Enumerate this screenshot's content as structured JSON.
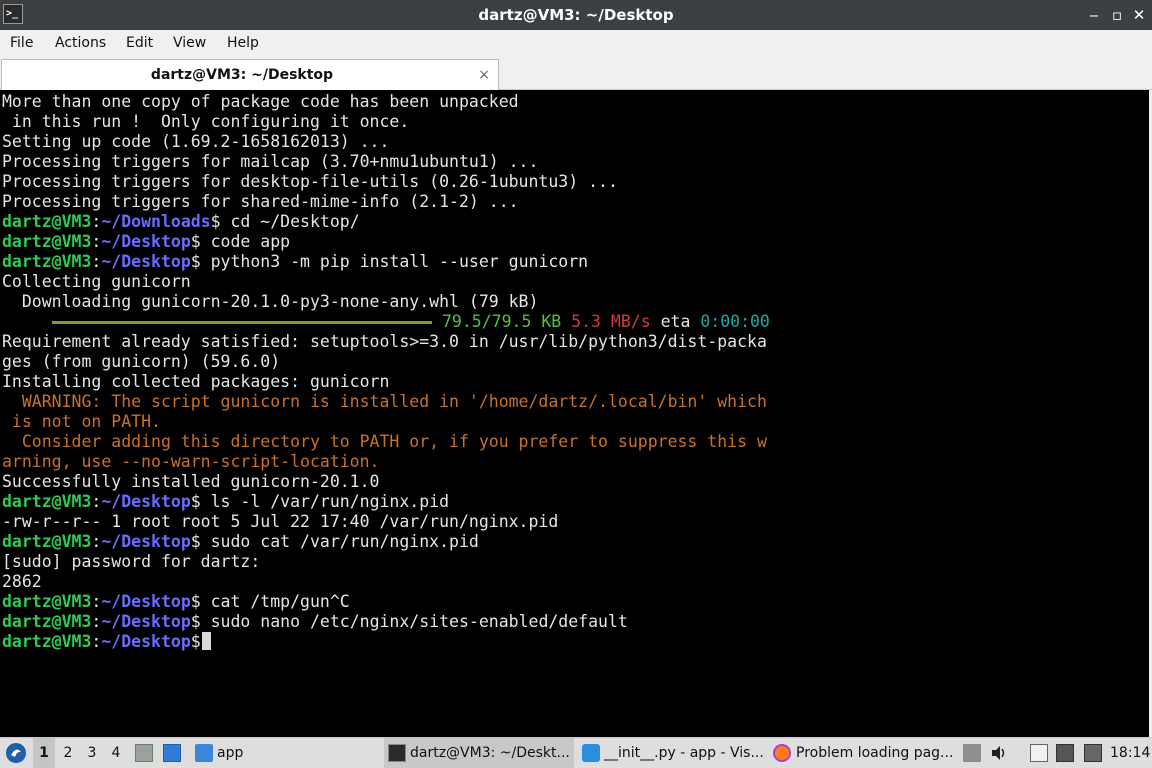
{
  "window": {
    "title": "dartz@VM3: ~/Desktop",
    "min_glyph": "‒",
    "max_glyph": "▫",
    "close_glyph": "✕",
    "app_icon_glyph": ">_"
  },
  "menu": [
    "File",
    "Actions",
    "Edit",
    "View",
    "Help"
  ],
  "tab": {
    "label": "dartz@VM3: ~/Desktop",
    "close_glyph": "×"
  },
  "prompt": {
    "user": "dartz@VM3",
    "sep": ":",
    "dollar": "$"
  },
  "terminal": {
    "lines": [
      {
        "type": "out",
        "text": "More than one copy of package code has been unpacked"
      },
      {
        "type": "out",
        "text": " in this run !  Only configuring it once."
      },
      {
        "type": "out",
        "text": "Setting up code (1.69.2-1658162013) ..."
      },
      {
        "type": "out",
        "text": "Processing triggers for mailcap (3.70+nmu1ubuntu1) ..."
      },
      {
        "type": "out",
        "text": "Processing triggers for desktop-file-utils (0.26-1ubuntu3) ..."
      },
      {
        "type": "out",
        "text": "Processing triggers for shared-mime-info (2.1-2) ..."
      },
      {
        "type": "prompt",
        "path": "~/Downloads",
        "cmd": " cd ~/Desktop/"
      },
      {
        "type": "prompt",
        "path": "~/Desktop",
        "cmd": " code app"
      },
      {
        "type": "prompt",
        "path": "~/Desktop",
        "cmd": " python3 -m pip install --user gunicorn"
      },
      {
        "type": "out",
        "text": "Collecting gunicorn"
      },
      {
        "type": "out",
        "text": "  Downloading gunicorn-20.1.0-py3-none-any.whl (79 kB)"
      },
      {
        "type": "progress",
        "size": "79.5/79.5 KB",
        "speed": "5.3 MB/s",
        "eta_label": "eta",
        "eta": "0:00:00",
        "progress": 1.0
      },
      {
        "type": "out",
        "text": "Requirement already satisfied: setuptools>=3.0 in /usr/lib/python3/dist-packa"
      },
      {
        "type": "out",
        "text": "ges (from gunicorn) (59.6.0)"
      },
      {
        "type": "out",
        "text": "Installing collected packages: gunicorn"
      },
      {
        "type": "warn",
        "text": "  WARNING: The script gunicorn is installed in '/home/dartz/.local/bin' which"
      },
      {
        "type": "warn",
        "text": " is not on PATH."
      },
      {
        "type": "warn",
        "text": "  Consider adding this directory to PATH or, if you prefer to suppress this w"
      },
      {
        "type": "warn",
        "text": "arning, use --no-warn-script-location."
      },
      {
        "type": "out",
        "text": "Successfully installed gunicorn-20.1.0"
      },
      {
        "type": "prompt",
        "path": "~/Desktop",
        "cmd": " ls -l /var/run/nginx.pid"
      },
      {
        "type": "out",
        "text": "-rw-r--r-- 1 root root 5 Jul 22 17:40 /var/run/nginx.pid"
      },
      {
        "type": "prompt",
        "path": "~/Desktop",
        "cmd": " sudo cat /var/run/nginx.pid"
      },
      {
        "type": "out",
        "text": "[sudo] password for dartz:"
      },
      {
        "type": "out",
        "text": "2862"
      },
      {
        "type": "prompt",
        "path": "~/Desktop",
        "cmd": " cat /tmp/gun^C"
      },
      {
        "type": "prompt",
        "path": "~/Desktop",
        "cmd": " sudo nano /etc/nginx/sites-enabled/default"
      },
      {
        "type": "prompt",
        "path": "~/Desktop",
        "cmd": " ",
        "cursor": true
      }
    ]
  },
  "taskbar": {
    "workspaces": [
      "1",
      "2",
      "3",
      "4"
    ],
    "active_workspace": "1",
    "folder_label": "app",
    "tasks": [
      {
        "label": "dartz@VM3: ~/Deskt...",
        "icon": "terminal-icon"
      },
      {
        "label": "__init__.py - app - Vis...",
        "icon": "vscode-icon"
      },
      {
        "label": "Problem loading pag...",
        "icon": "firefox-icon"
      }
    ],
    "clock": "18:14"
  },
  "colors": {
    "titlebar": "#3c4043",
    "terminal_bg": "#000000",
    "prompt_user": "#2ecc52",
    "prompt_path": "#6a6cff",
    "warning": "#c8722a",
    "progress_bar": "#7e9f2e"
  }
}
